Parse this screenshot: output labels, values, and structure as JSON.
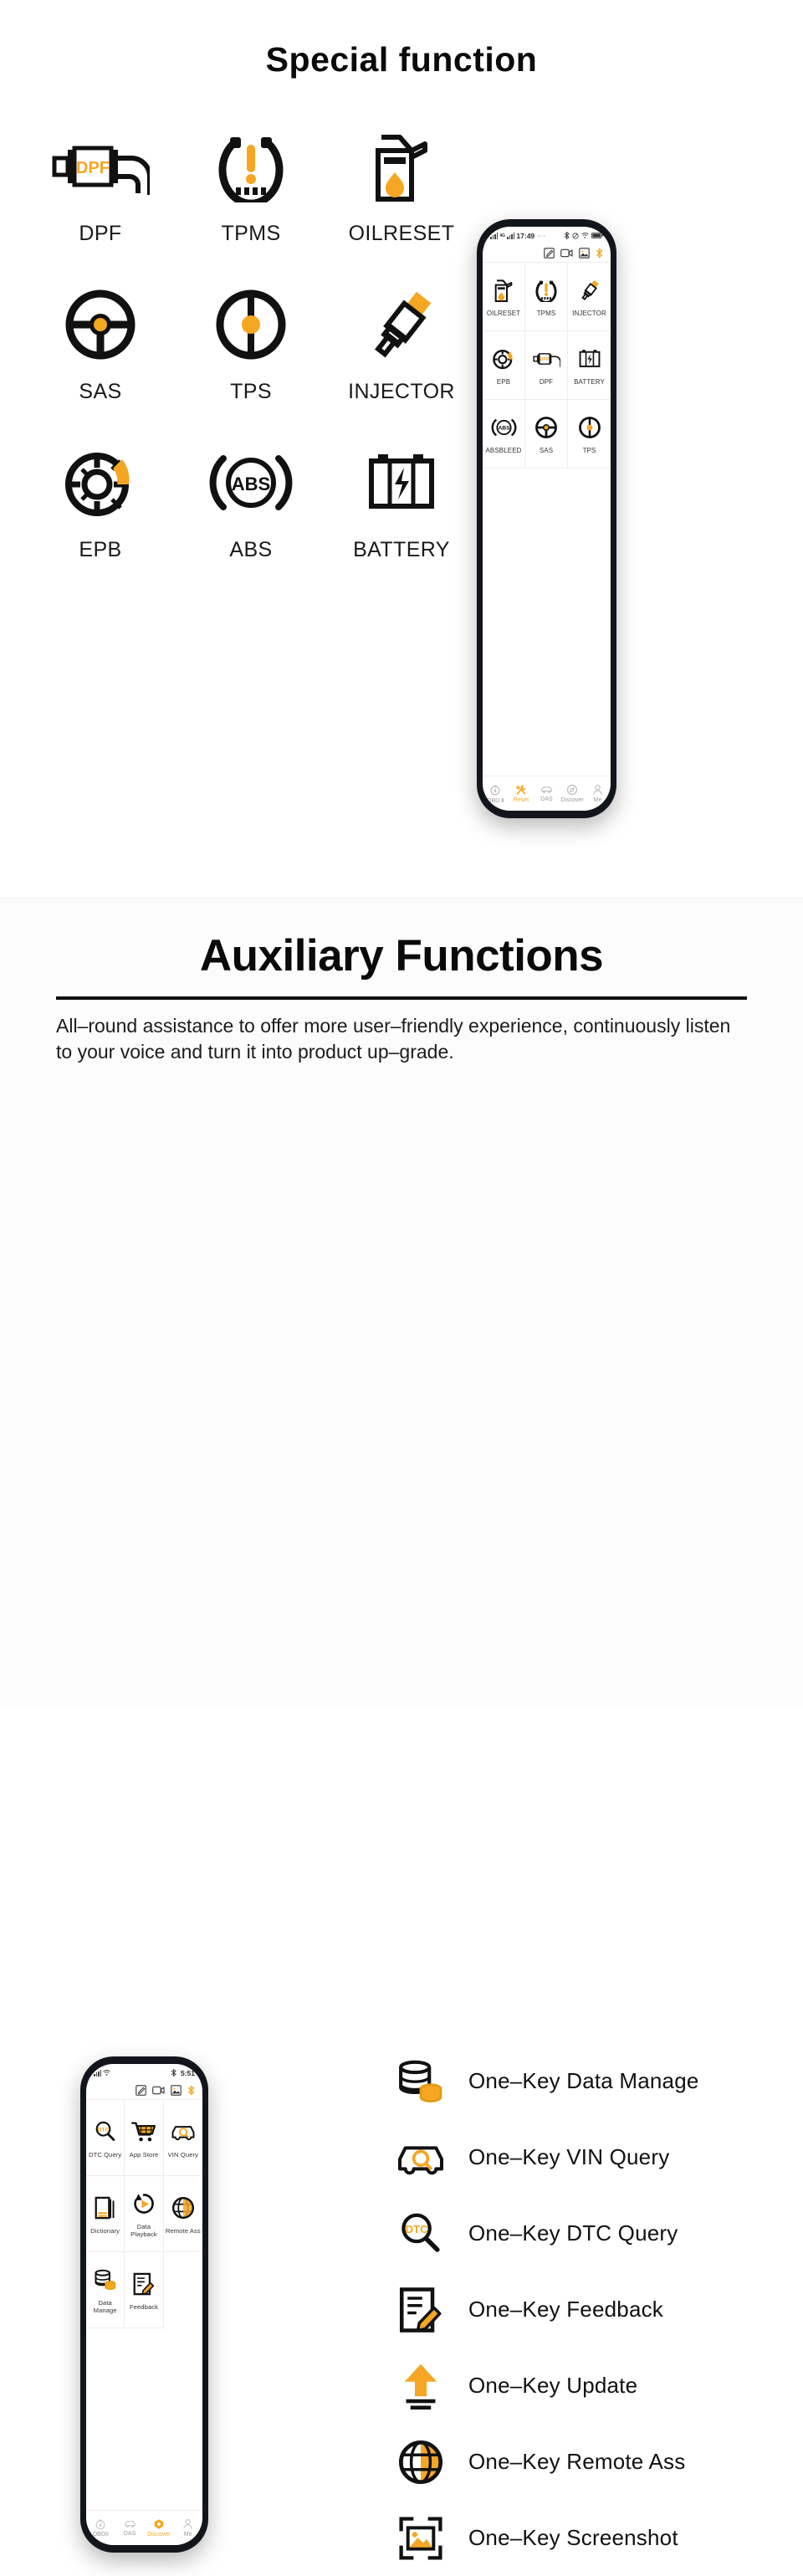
{
  "colors": {
    "accent": "#f5a623",
    "accent_deep": "#f2a115",
    "text": "#111111",
    "muted": "#9a9a9a"
  },
  "section_one": {
    "title": "Special function",
    "functions": [
      {
        "label": "DPF",
        "icon": "dpf-filter-icon"
      },
      {
        "label": "TPMS",
        "icon": "tire-pressure-icon"
      },
      {
        "label": "OILRESET",
        "icon": "oil-can-icon"
      },
      {
        "label": "SAS",
        "icon": "steering-wheel-icon"
      },
      {
        "label": "TPS",
        "icon": "throttle-position-icon"
      },
      {
        "label": "INJECTOR",
        "icon": "injector-icon"
      },
      {
        "label": "EPB",
        "icon": "electronic-parking-brake-icon"
      },
      {
        "label": "ABS",
        "icon": "abs-brake-icon"
      },
      {
        "label": "BATTERY",
        "icon": "battery-icon"
      }
    ],
    "phone": {
      "status_bar": {
        "network": "4G",
        "time": "17:49",
        "dots": "···"
      },
      "action_icons": [
        "feedback-icon",
        "video-icon",
        "screenshot-icon",
        "bluetooth-icon"
      ],
      "grid": [
        {
          "label": "OILRESET",
          "icon": "oil-can-icon"
        },
        {
          "label": "TPMS",
          "icon": "tire-pressure-icon"
        },
        {
          "label": "INJECTOR",
          "icon": "injector-icon"
        },
        {
          "label": "EPB",
          "icon": "electronic-parking-brake-icon"
        },
        {
          "label": "DPF",
          "icon": "dpf-filter-icon"
        },
        {
          "label": "BATTERY",
          "icon": "battery-icon"
        },
        {
          "label": "ABSBLEED",
          "icon": "abs-brake-icon"
        },
        {
          "label": "SAS",
          "icon": "steering-wheel-icon"
        },
        {
          "label": "TPS",
          "icon": "throttle-position-icon"
        }
      ],
      "nav": [
        {
          "label": "OBD Ⅱ",
          "icon": "obd-gauge-icon",
          "active": false
        },
        {
          "label": "Reset",
          "icon": "tools-icon",
          "active": true
        },
        {
          "label": "DAS",
          "icon": "car-scan-icon",
          "active": false
        },
        {
          "label": "Discover",
          "icon": "compass-icon",
          "active": false
        },
        {
          "label": "Me",
          "icon": "user-icon",
          "active": false
        }
      ]
    }
  },
  "section_two": {
    "title": "Auxiliary Functions",
    "description": "All–round assistance to offer more user–friendly experience, continuously listen to your voice and turn it into product up–grade.",
    "phone": {
      "status_bar": {
        "time": "5:51"
      },
      "action_icons": [
        "feedback-icon",
        "video-icon",
        "screenshot-icon",
        "bluetooth-icon"
      ],
      "grid": [
        {
          "label": "DTC Query",
          "icon": "dtc-magnifier-icon"
        },
        {
          "label": "App Store",
          "icon": "shopping-cart-icon"
        },
        {
          "label": "VIN Query",
          "icon": "vin-car-icon"
        },
        {
          "label": "Dictionary",
          "icon": "book-icon"
        },
        {
          "label": "Data Playback",
          "icon": "playback-icon"
        },
        {
          "label": "Remote Ass",
          "icon": "globe-icon"
        },
        {
          "label": "Data Manage",
          "icon": "database-icon"
        },
        {
          "label": "Feedback",
          "icon": "feedback-icon"
        }
      ],
      "nav": [
        {
          "label": "OBDII",
          "icon": "obd-gauge-icon",
          "active": false
        },
        {
          "label": "DAS",
          "icon": "car-scan-icon",
          "active": false
        },
        {
          "label": "Discover",
          "icon": "hex-icon",
          "active": true
        },
        {
          "label": "Me",
          "icon": "user-icon",
          "active": false
        }
      ]
    },
    "features": [
      {
        "label": "One–Key Data Manage",
        "icon": "database-icon"
      },
      {
        "label": "One–Key VIN Query",
        "icon": "vin-car-icon"
      },
      {
        "label": "One–Key DTC Query",
        "icon": "dtc-magnifier-icon"
      },
      {
        "label": "One–Key Feedback",
        "icon": "feedback-icon"
      },
      {
        "label": "One–Key Update",
        "icon": "update-arrow-icon"
      },
      {
        "label": "One–Key Remote Ass",
        "icon": "globe-icon"
      },
      {
        "label": "One–Key Screenshot",
        "icon": "screenshot-icon"
      }
    ]
  }
}
